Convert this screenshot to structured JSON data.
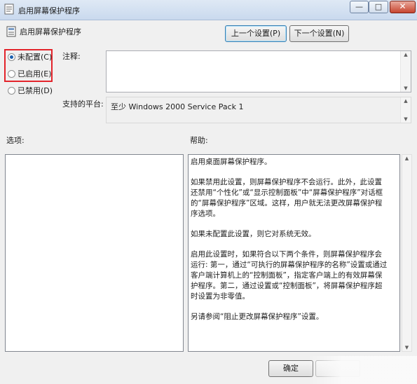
{
  "window": {
    "title": "启用屏幕保护程序"
  },
  "titlebar_buttons": {
    "minimize": "—",
    "maximize": "□",
    "close": "✕"
  },
  "header": {
    "title": "启用屏幕保护程序",
    "prev_button": "上一个设置(P)",
    "next_button": "下一个设置(N)"
  },
  "radios": [
    {
      "label": "未配置(C)",
      "checked": true
    },
    {
      "label": "已启用(E)",
      "checked": false
    },
    {
      "label": "已禁用(D)",
      "checked": false
    }
  ],
  "comment": {
    "label": "注释:",
    "value": ""
  },
  "supported": {
    "label": "支持的平台:",
    "value": "至少 Windows 2000 Service Pack 1"
  },
  "options": {
    "label": "选项:"
  },
  "help": {
    "label": "帮助:",
    "paragraphs": [
      "启用桌面屏幕保护程序。",
      "如果禁用此设置，则屏幕保护程序不会运行。此外，此设置还禁用“个性化”或“显示控制面板”中“屏幕保护程序”对话框的“屏幕保护程序”区域。这样，用户就无法更改屏幕保护程序选项。",
      "如果未配置此设置，则它对系统无效。",
      "启用此设置时，如果符合以下两个条件，则屏幕保护程序会运行: 第一，通过“可执行的屏幕保护程序的名称”设置或通过客户端计算机上的“控制面板”，指定客户端上的有效屏幕保护程序。第二，通过设置或“控制面板”，将屏幕保护程序超时设置为非零值。",
      "另请参阅“阻止更改屏幕保护程序”设置。"
    ]
  },
  "footer": {
    "ok_button": "确定"
  },
  "colors": {
    "highlight_border": "#e3242b",
    "radio_dot": "#1a5fae"
  }
}
